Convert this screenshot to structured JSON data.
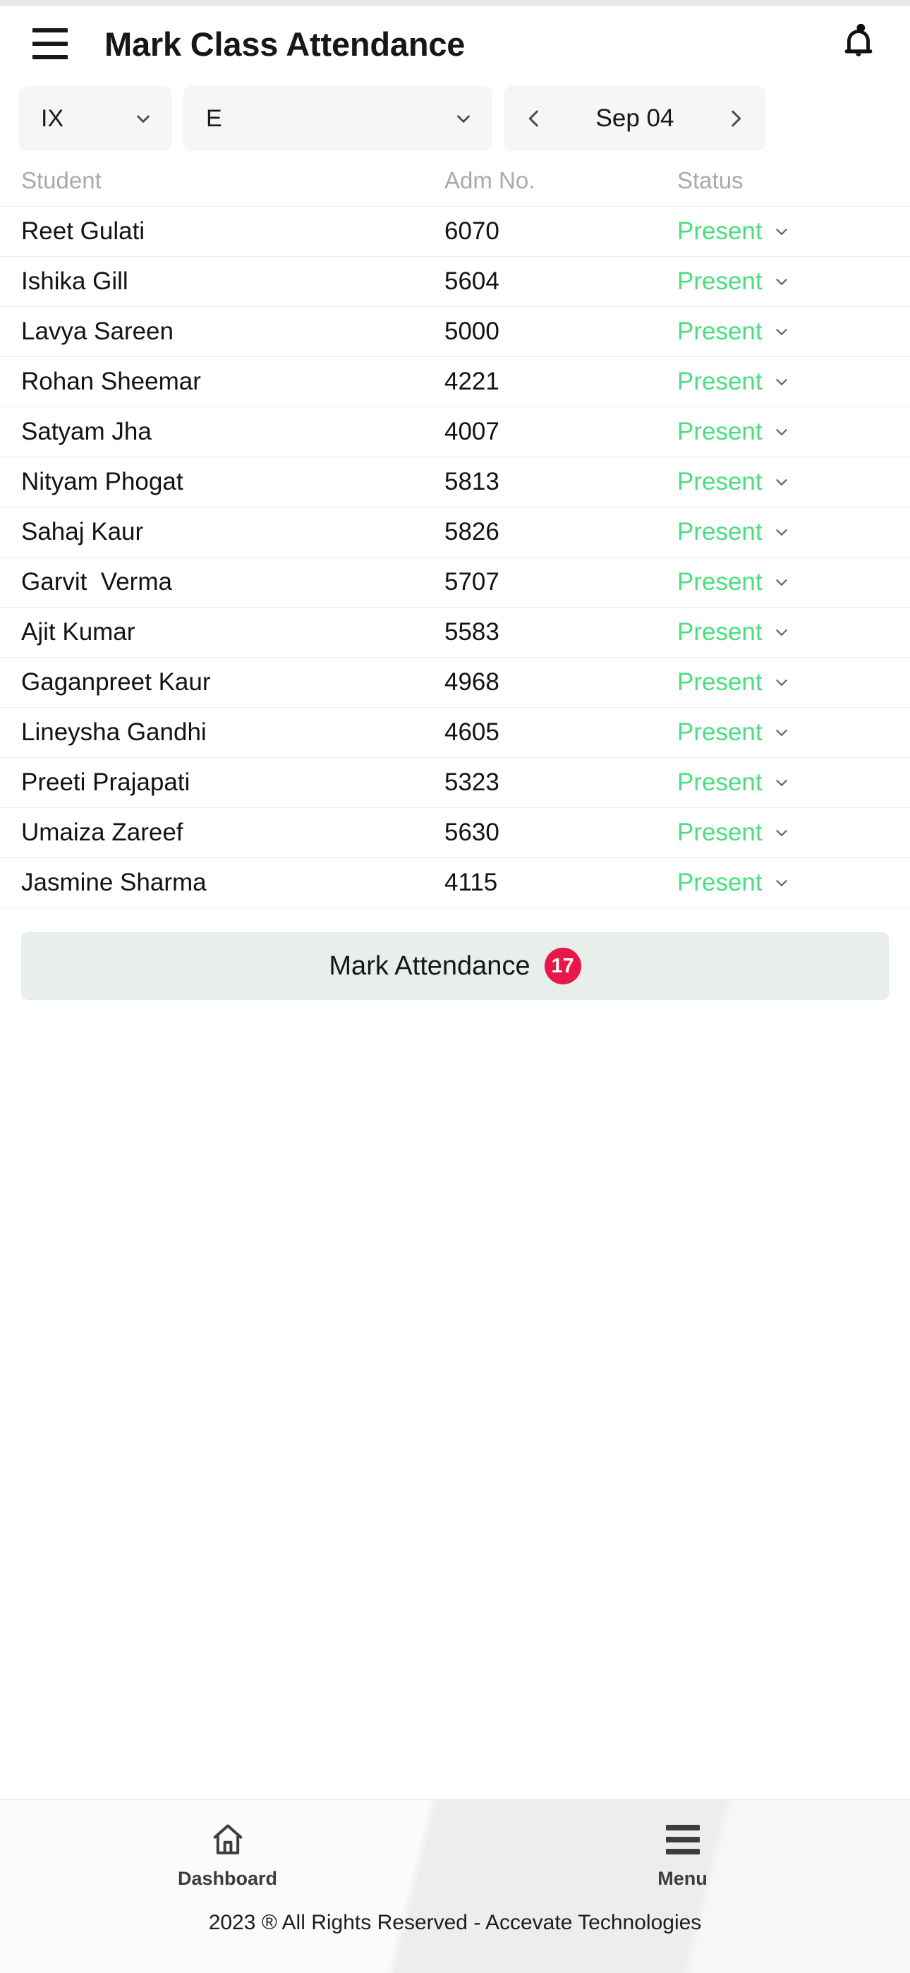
{
  "header": {
    "menu_icon": "hamburger-icon",
    "title": "Mark Class Attendance",
    "notification_icon": "bell-icon"
  },
  "filters": {
    "class_value": "IX",
    "section_value": "E",
    "date_value": "Sep 04",
    "prev_icon": "chevron-left-icon",
    "next_icon": "chevron-right-icon",
    "dropdown_icon": "chevron-down-icon"
  },
  "table": {
    "columns": [
      "Student",
      "Adm No.",
      "Status"
    ],
    "status_color": "#4ade80",
    "rows": [
      {
        "name": "Reet Gulati",
        "adm": "6070",
        "status": "Present"
      },
      {
        "name": "Ishika Gill",
        "adm": "5604",
        "status": "Present"
      },
      {
        "name": "Lavya Sareen",
        "adm": "5000",
        "status": "Present"
      },
      {
        "name": "Rohan Sheemar",
        "adm": "4221",
        "status": "Present"
      },
      {
        "name": "Satyam Jha",
        "adm": "4007",
        "status": "Present"
      },
      {
        "name": "Nityam Phogat",
        "adm": "5813",
        "status": "Present"
      },
      {
        "name": "Sahaj Kaur",
        "adm": "5826",
        "status": "Present"
      },
      {
        "name": "Garvit  Verma",
        "adm": "5707",
        "status": "Present"
      },
      {
        "name": "Ajit Kumar",
        "adm": "5583",
        "status": "Present"
      },
      {
        "name": "Gaganpreet Kaur",
        "adm": "4968",
        "status": "Present"
      },
      {
        "name": "Lineysha Gandhi",
        "adm": "4605",
        "status": "Present"
      },
      {
        "name": "Preeti Prajapati",
        "adm": "5323",
        "status": "Present"
      },
      {
        "name": "Umaiza Zareef",
        "adm": "5630",
        "status": "Present"
      },
      {
        "name": "Jasmine Sharma",
        "adm": "4115",
        "status": "Present"
      }
    ]
  },
  "action": {
    "mark_label": "Mark Attendance",
    "mark_count": "17",
    "badge_color": "#e8174a",
    "button_color": "#e8eeea"
  },
  "footer": {
    "nav": [
      {
        "label": "Dashboard",
        "icon": "home-icon"
      },
      {
        "label": "Menu",
        "icon": "hamburger-icon"
      }
    ],
    "copyright": "2023 ® All Rights Reserved - Accevate Technologies"
  }
}
